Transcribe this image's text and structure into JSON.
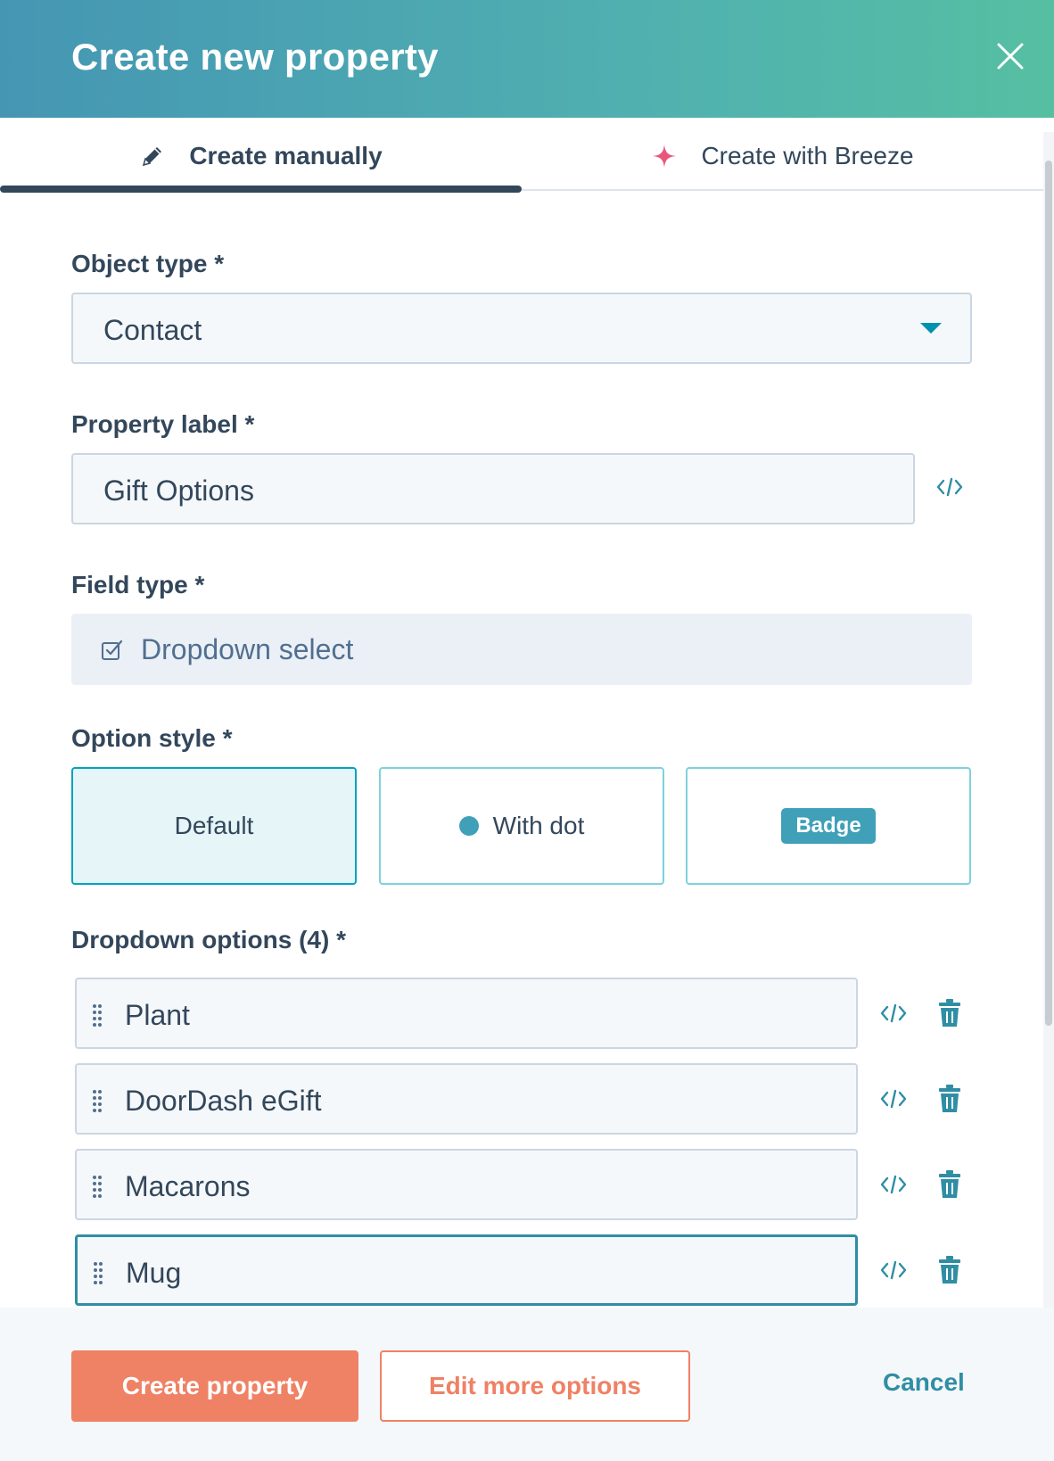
{
  "dialog": {
    "title": "Create new property"
  },
  "tabs": [
    {
      "label": "Create manually",
      "icon": "pencil-icon",
      "active": true
    },
    {
      "label": "Create with Breeze",
      "icon": "sparkle-icon",
      "active": false
    }
  ],
  "object_type": {
    "label": "Object type *",
    "value": "Contact"
  },
  "property_label": {
    "label": "Property label *",
    "value": "Gift Options"
  },
  "field_type": {
    "label": "Field type *",
    "value": "Dropdown select"
  },
  "option_style": {
    "label": "Option style *",
    "options": [
      "Default",
      "With dot",
      "Badge"
    ],
    "selected": "Default"
  },
  "dropdown_options": {
    "label": "Dropdown options (4) *",
    "items": [
      "Plant",
      "DoorDash eGift",
      "Macarons",
      "Mug"
    ]
  },
  "footer": {
    "create_label": "Create property",
    "edit_label": "Edit more options",
    "cancel_label": "Cancel"
  },
  "colors": {
    "header_gradient_start": "#4596b3",
    "header_gradient_end": "#56bfa2",
    "accent_teal": "#00a4bd",
    "primary_button": "#ef8165",
    "text": "#33475b"
  }
}
